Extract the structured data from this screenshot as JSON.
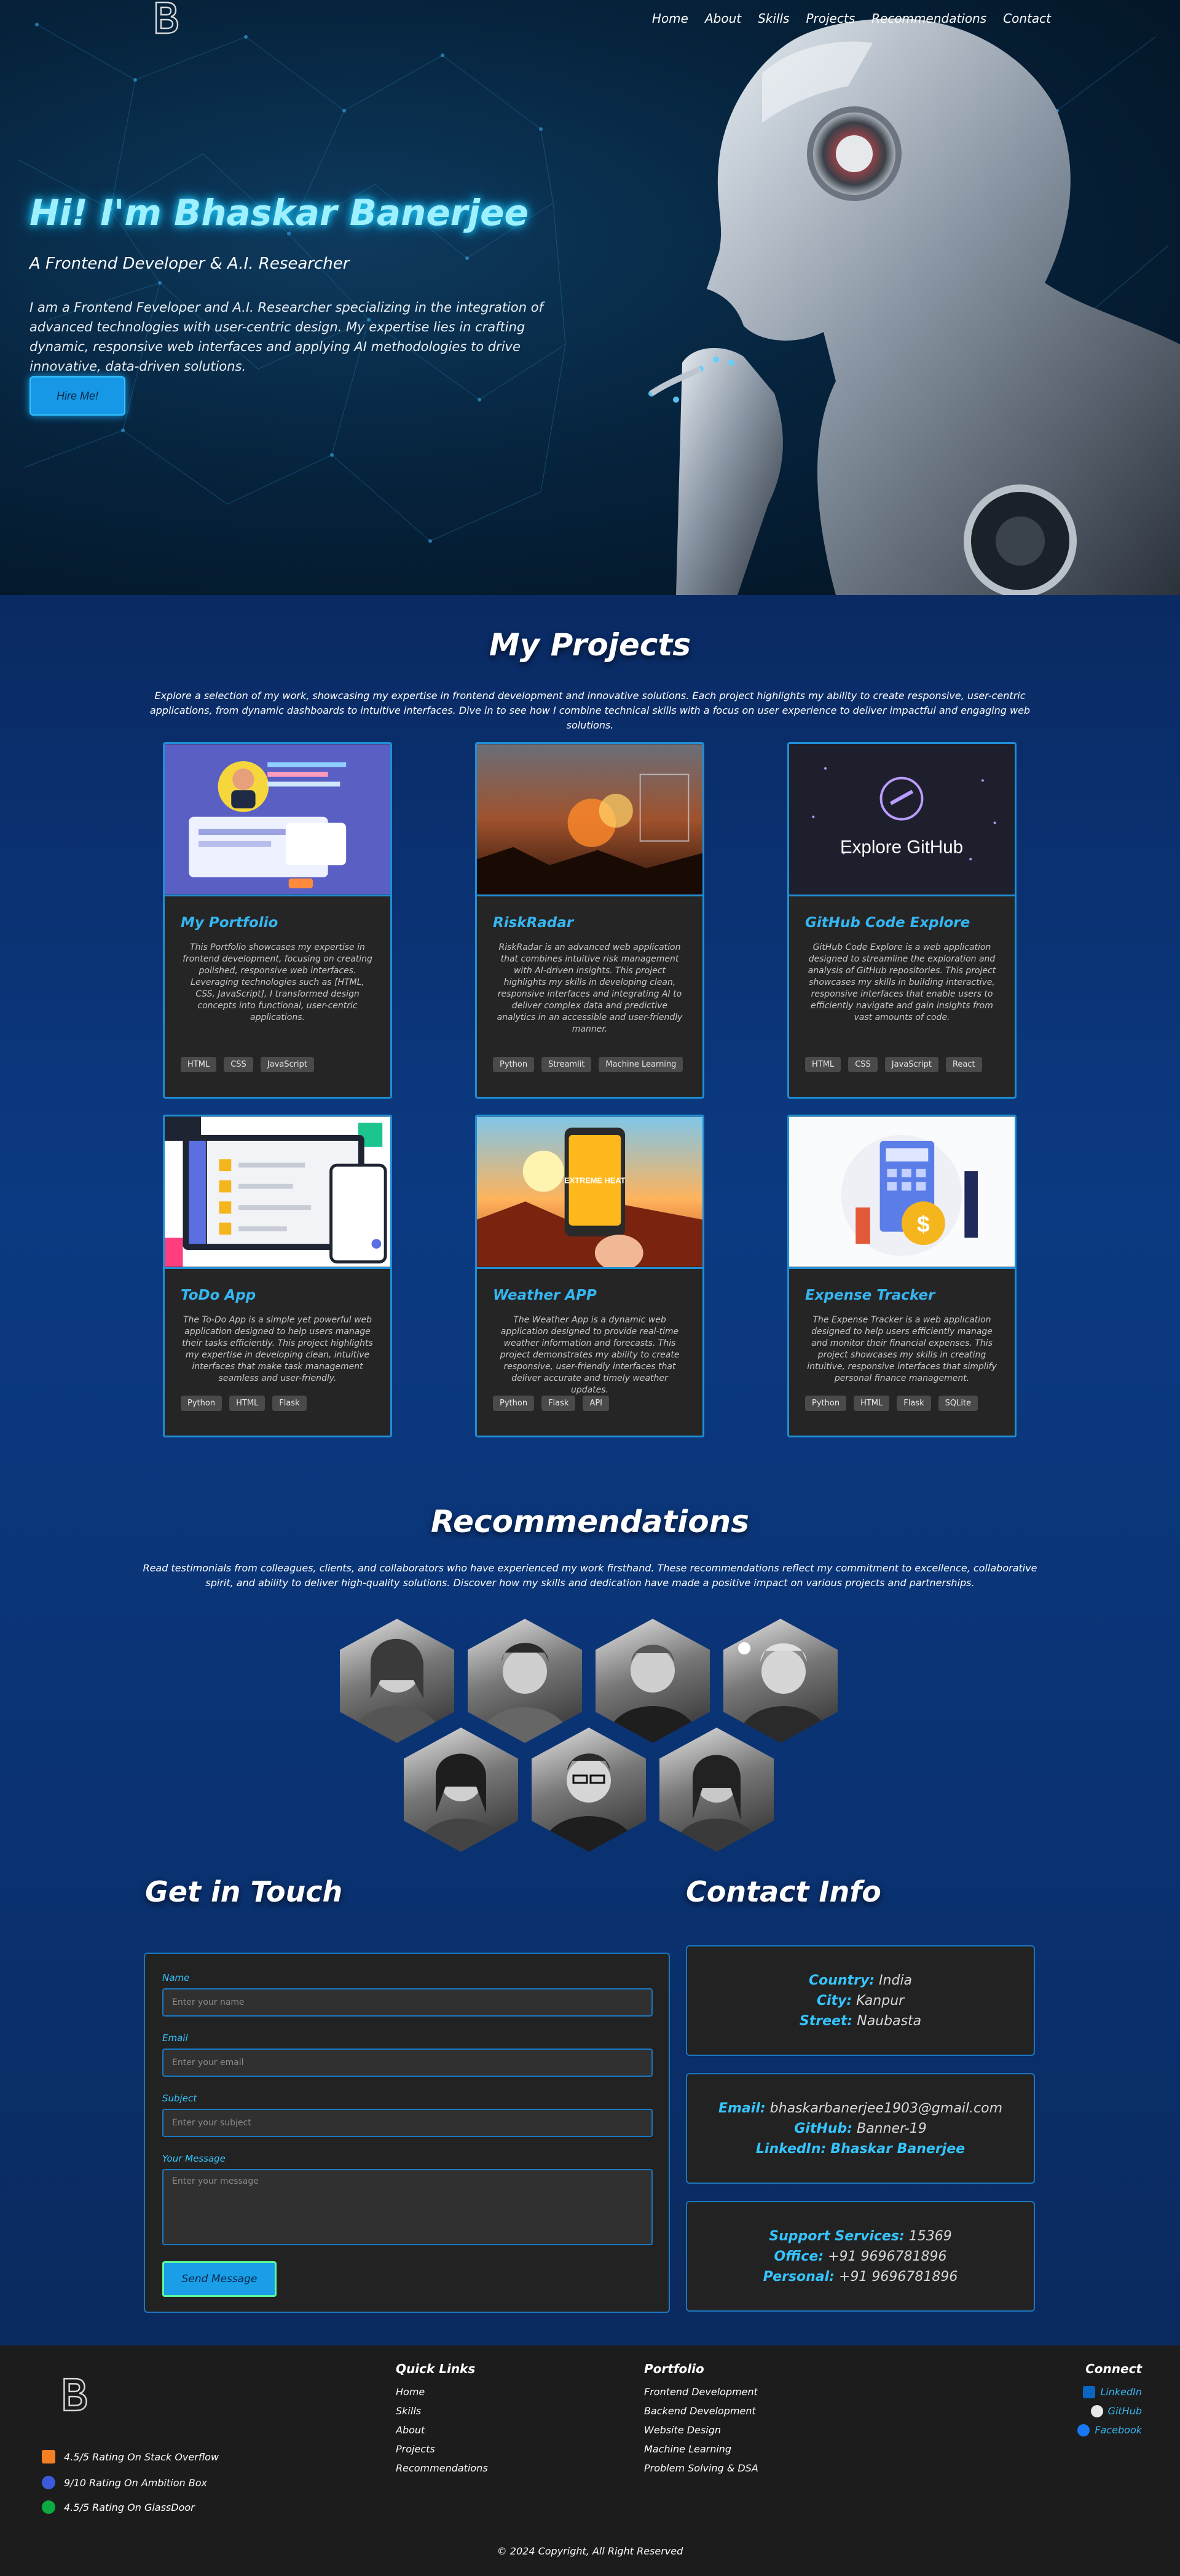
{
  "nav": {
    "logo": "logo-icon",
    "links": [
      "Home",
      "About",
      "Skills",
      "Projects",
      "Recommendations",
      "Contact"
    ]
  },
  "hero": {
    "title": "Hi! I'm Bhaskar Banerjee",
    "subtitle": "A Frontend Developer & A.I. Researcher",
    "description": "I am a Frontend Feveloper and A.I. Researcher specializing in the integration of advanced technologies with user-centric design. My expertise lies in crafting dynamic, responsive web interfaces and applying AI methodologies to drive innovative, data-driven solutions.",
    "cta": "Hire Me!"
  },
  "projects": {
    "title": "My Projects",
    "description": "Explore a selection of my work, showcasing my expertise in frontend development and innovative solutions. Each project highlights my ability to create responsive, user-centric applications, from dynamic dashboards to intuitive interfaces. Dive in to see how I combine technical skills with a focus on user experience to deliver impactful and engaging web solutions.",
    "items": [
      {
        "title": "My Portfolio",
        "desc": "This Portfolio showcases my expertise in frontend development, focusing on creating polished, responsive web interfaces. Leveraging technologies such as [HTML, CSS, JavaScript], I transformed design concepts into functional, user-centric applications.",
        "tags": [
          "HTML",
          "CSS",
          "JavaScript"
        ]
      },
      {
        "title": "RiskRadar",
        "desc": "RiskRadar is an advanced web application that combines intuitive risk management with AI-driven insights. This project highlights my skills in developing clean, responsive interfaces and integrating AI to deliver complex data and predictive analytics in an accessible and user-friendly manner.",
        "tags": [
          "Python",
          "Streamlit",
          "Machine Learning"
        ]
      },
      {
        "title": "GitHub Code Explore",
        "desc": "GitHub Code Explore is a web application designed to streamline the exploration and analysis of GitHub repositories. This project showcases my skills in building interactive, responsive interfaces that enable users to efficiently navigate and gain insights from vast amounts of code.",
        "tags": [
          "HTML",
          "CSS",
          "JavaScript",
          "React"
        ],
        "thumb_text": "Explore GitHub"
      },
      {
        "title": "ToDo App",
        "desc": "The To-Do App is a simple yet powerful web application designed to help users manage their tasks efficiently. This project highlights my expertise in developing clean, intuitive interfaces that make task management seamless and user-friendly.",
        "tags": [
          "Python",
          "HTML",
          "Flask"
        ]
      },
      {
        "title": "Weather APP",
        "desc": "The Weather App is a dynamic web application designed to provide real-time weather information and forecasts. This project demonstrates my ability to create responsive, user-friendly interfaces that deliver accurate and timely weather updates.",
        "tags": [
          "Python",
          "Flask",
          "API"
        ],
        "thumb_text": "EXTREME HEAT"
      },
      {
        "title": "Expense Tracker",
        "desc": "The Expense Tracker is a web application designed to help users efficiently manage and monitor their financial expenses. This project showcases my skills in creating intuitive, responsive interfaces that simplify personal finance management.",
        "tags": [
          "Python",
          "HTML",
          "Flask",
          "SQLite"
        ]
      }
    ]
  },
  "recommendations": {
    "title": "Recommendations",
    "description": "Read testimonials from colleagues, clients, and collaborators who have experienced my work firsthand. These recommendations reflect my commitment to excellence, collaborative spirit, and ability to deliver high-quality solutions. Discover how my skills and dedication have made a positive impact on various projects and partnerships."
  },
  "contact": {
    "title": "Get in Touch",
    "name_label": "Name",
    "name_placeholder": "Enter your name",
    "email_label": "Email",
    "email_placeholder": "Enter your email",
    "subject_label": "Subject",
    "subject_placeholder": "Enter your subject",
    "message_label": "Your Message",
    "message_placeholder": "Enter your message",
    "send": "Send Message"
  },
  "contact_info": {
    "title": "Contact Info",
    "country_k": "Country:",
    "country_v": "India",
    "city_k": "City:",
    "city_v": "Kanpur",
    "street_k": "Street:",
    "street_v": "Naubasta",
    "email_k": "Email:",
    "email_v": "bhaskarbanerjee1903@gmail.com",
    "github_k": "GitHub:",
    "github_v": "Banner-19",
    "linkedin_k": "LinkedIn:",
    "linkedin_v": "Bhaskar Banerjee",
    "support_k": "Support Services:",
    "support_v": "15369",
    "office_k": "Office:",
    "office_v": "+91 9696781896",
    "personal_k": "Personal:",
    "personal_v": "+91 9696781896"
  },
  "footer": {
    "quick_links_title": "Quick Links",
    "quick_links": [
      "Home",
      "Skills",
      "About",
      "Projects",
      "Recommendations"
    ],
    "portfolio_title": "Portfolio",
    "portfolio": [
      "Frontend Development",
      "Backend Development",
      "Website Design",
      "Machine Learning",
      "Problem Solving & DSA"
    ],
    "connect_title": "Connect",
    "connect": [
      "LinkedIn",
      "GitHub",
      "Facebook"
    ],
    "ratings": [
      "4.5/5 Rating On Stack Overflow",
      "9/10 Rating On Ambition Box",
      "4.5/5 Rating On GlassDoor"
    ],
    "copyright": "© 2024 Copyright, All Right Reserved"
  },
  "colors": {
    "accent": "#35b6f2",
    "card_border": "#1f8ed6",
    "footer_bg": "#1c1c1c"
  }
}
